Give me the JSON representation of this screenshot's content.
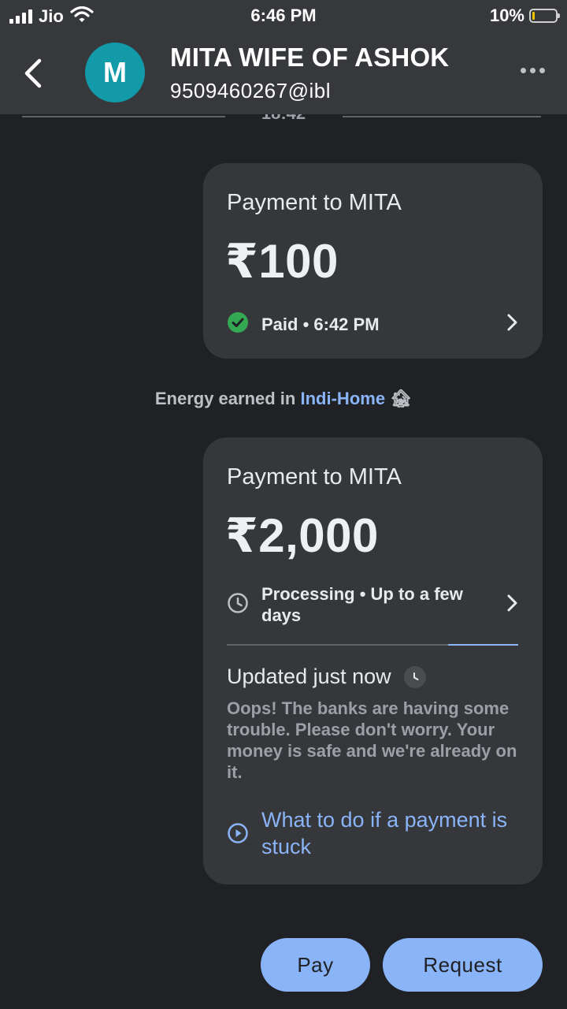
{
  "status_bar": {
    "carrier": "Jio",
    "time": "6:46 PM",
    "battery": "10%",
    "battery_level": 0.1,
    "icons": [
      "signal-bars-icon",
      "wifi-icon",
      "battery-icon"
    ]
  },
  "header": {
    "avatar_letter": "M",
    "avatar_color": "#139aa9",
    "name": "MITA WIFE OF ASHOK",
    "upi_id": "9509460267@ibl",
    "icons": [
      "back-arrow-icon",
      "more-options-icon"
    ]
  },
  "date_divider": "18:42",
  "payments": [
    {
      "title": "Payment to MITA",
      "amount": "₹100",
      "status": "Paid • 6:42 PM",
      "status_icon": "check-circle-icon",
      "status_color": "#1e8e3e"
    },
    {
      "title": "Payment to MITA",
      "amount": "₹2,000",
      "status": "Processing • Up to a few days",
      "status_icon": "clock-icon",
      "progress": 0.24,
      "updated": "Updated just now",
      "message": "Oops! The banks are having some trouble. Please don't worry. Your money is safe and we're already on it.",
      "help_link": "What to do if a payment is stuck"
    }
  ],
  "energy": {
    "prefix": "Energy earned in",
    "place": "Indi-Home",
    "emoji": "🏚"
  },
  "actions": {
    "pay": "Pay",
    "request": "Request"
  },
  "colors": {
    "background": "#202124",
    "card": "#36373a",
    "accent": "#8ab4f8",
    "header": "#36383c"
  }
}
